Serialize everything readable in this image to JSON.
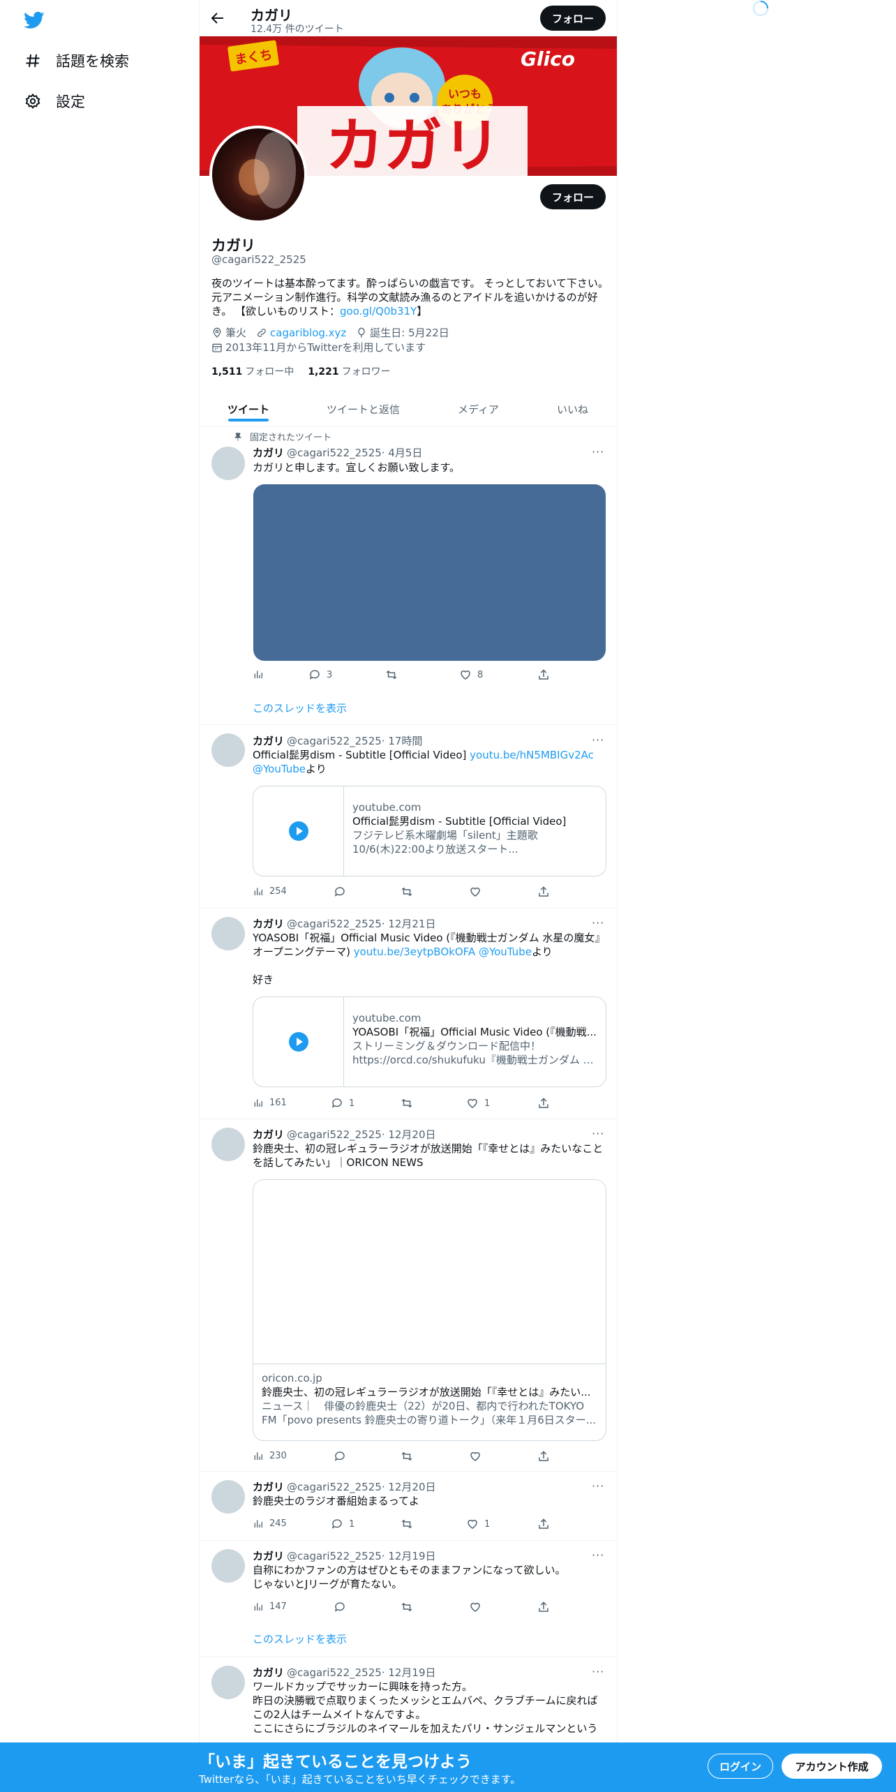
{
  "nav": {
    "explore_label": "話題を検索",
    "settings_label": "設定"
  },
  "header": {
    "name": "カガリ",
    "tweet_count": "12.4万 件のツイート",
    "follow_label": "フォロー"
  },
  "profile": {
    "name": "カガリ",
    "handle": "@cagari522_2525",
    "follow_label": "フォロー",
    "bio_text": "夜のツイートは基本酔ってます。酔っぱらいの戯言です。 そっとしておいて下さい。元アニメーション制作進行。科学の文献読み漁るのとアイドルを追いかけるのが好き。 【欲しいものリスト：",
    "bio_link": "goo.gl/Q0b31Y",
    "bio_end": "】",
    "location": "筆火",
    "website": "cagariblog.xyz",
    "birthday": "誕生日: 5月22日",
    "joined": "2013年11月からTwitterを利用しています",
    "following_count": "1,511",
    "following_label": "フォロー中",
    "followers_count": "1,221",
    "followers_label": "フォロワー"
  },
  "banner": {
    "tag_text": "まくち",
    "thanks_text_1": "いつも",
    "thanks_text_2": "ありがとう",
    "product_text": "カガリ",
    "brand_text": "Glico"
  },
  "tabs": [
    "ツイート",
    "ツイートと返信",
    "メディア",
    "いいね"
  ],
  "pinned_label": "固定されたツイート",
  "show_thread_label": "このスレッドを表示",
  "tweets": [
    {
      "name": "カガリ",
      "handle": "@cagari522_2525",
      "time": "· 4月5日",
      "text": "カガリと申します。宜しくお願い致します。",
      "replies": "3",
      "retweets": "",
      "likes": "8",
      "views": ""
    },
    {
      "name": "カガリ",
      "handle": "@cagari522_2525",
      "time": "· 17時間",
      "text_1": "Official髭男dism - Subtitle [Official Video] ",
      "link_1": "youtu.be/hN5MBIGv2Ac",
      "link_2": "@YouTube",
      "text_2": "より",
      "card_domain": "youtube.com",
      "card_title": "Official髭男dism - Subtitle [Official Video]",
      "card_desc": "フジテレビ系木曜劇場「silent」主題歌10/6(木)22:00より放送スタート...",
      "views": "254",
      "replies": "",
      "retweets": "",
      "likes": ""
    },
    {
      "name": "カガリ",
      "handle": "@cagari522_2525",
      "time": "· 12月21日",
      "text_1": "YOASOBI「祝福」Official Music Video (『機動戦士ガンダム 水星の魔女』オープニングテーマ) ",
      "link_1": "youtu.be/3eytpBOkOFA",
      "link_2": "@YouTube",
      "text_2": "より",
      "text_3": "好き",
      "card_domain": "youtube.com",
      "card_title": "YOASOBI「祝福」Official Music Video (『機動戦...",
      "card_desc": "ストリーミング＆ダウンロード配信中！ https://orcd.co/shukufuku『機動戦士ガンダム 水星...",
      "views": "161",
      "replies": "1",
      "retweets": "",
      "likes": "1"
    },
    {
      "name": "カガリ",
      "handle": "@cagari522_2525",
      "time": "· 12月20日",
      "text": "鈴鹿央士、初の冠レギュラーラジオが放送開始「『幸せとは』みたいなことを話してみたい」｜ORICON NEWS",
      "card_domain": "oricon.co.jp",
      "card_title": "鈴鹿央士、初の冠レギュラーラジオが放送開始「『幸せとは』みたい...",
      "card_desc": "ニュース｜　俳優の鈴鹿央士（22）が20日、都内で行われたTOKYO FM「povo presents 鈴鹿央士の寄り道トーク」（来年１月6日スター...",
      "views": "230",
      "replies": "",
      "retweets": "",
      "likes": ""
    },
    {
      "name": "カガリ",
      "handle": "@cagari522_2525",
      "time": "· 12月20日",
      "text": "鈴鹿央士のラジオ番組始まるってよ",
      "views": "245",
      "replies": "1",
      "retweets": "",
      "likes": "1"
    },
    {
      "name": "カガリ",
      "handle": "@cagari522_2525",
      "time": "· 12月19日",
      "text_1": "自称にわかファンの方はぜひともそのままファンになって欲しい。",
      "text_2": "じゃないとJリーグが育たない。",
      "views": "147",
      "replies": "",
      "retweets": "",
      "likes": ""
    },
    {
      "name": "カガリ",
      "handle": "@cagari522_2525",
      "time": "· 12月19日",
      "text_1": "ワールドカップでサッカーに興味を持った方。",
      "text_2": "昨日の決勝戦で点取りまくったメッシとエムバペ、クラブチームに戻ればこの2人はチームメイトなんですよ。",
      "text_3": "ここにさらにブラジルのネイマールを加えたパリ・サンジェルマンという"
    }
  ],
  "bottom": {
    "headline": "「いま」起きていることを見つけよう",
    "sub": "Twitterなら、「いま」起きていることをいち早くチェックできます。",
    "login_label": "ログイン",
    "signup_label": "アカウント作成"
  },
  "colors": {
    "accent": "#1d9bf0",
    "text": "#0f1419",
    "muted": "#536471",
    "media_placeholder": "#456b96"
  }
}
